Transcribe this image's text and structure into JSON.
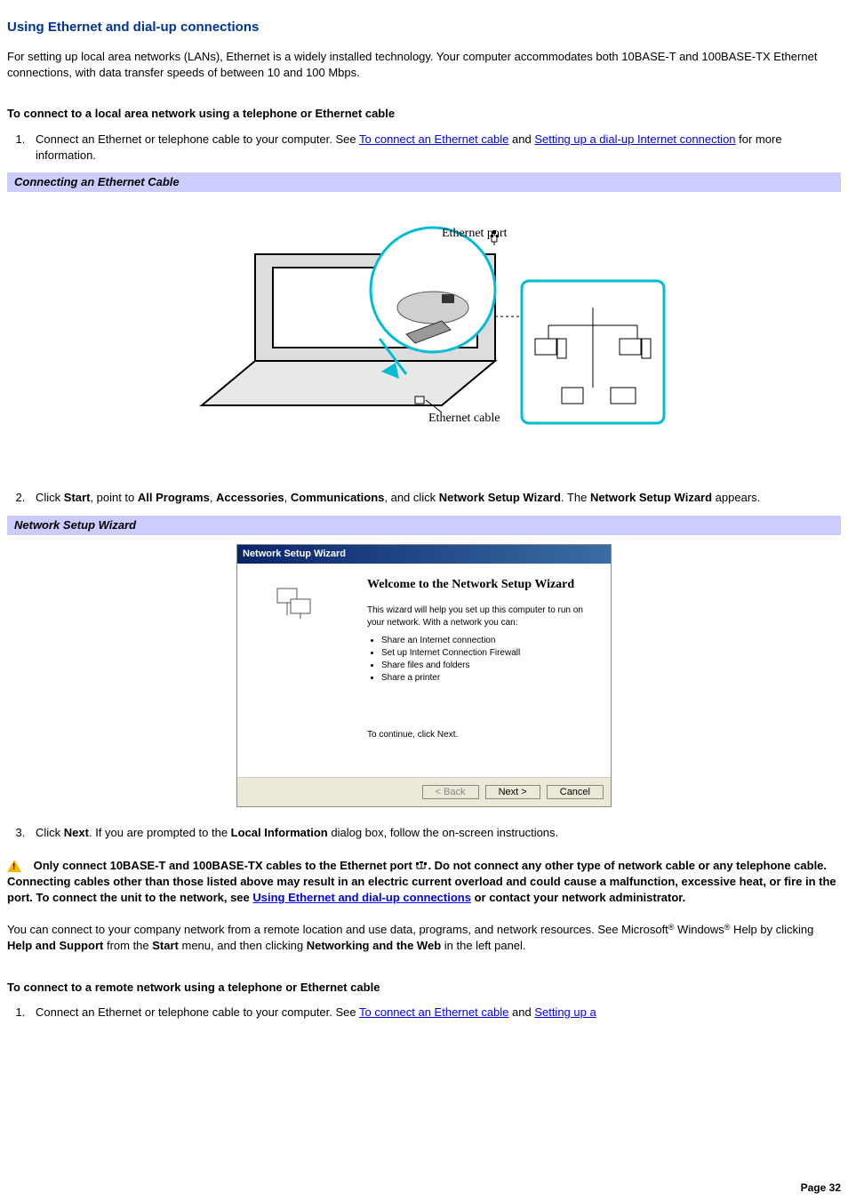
{
  "title": "Using Ethernet and dial-up connections",
  "intro": "For setting up local area networks (LANs), Ethernet is a widely installed technology. Your computer accommodates both 10BASE-T and 100BASE-TX Ethernet connections, with data transfer speeds of between 10 and 100 Mbps.",
  "section1_heading": "To connect to a local area network using a telephone or Ethernet cable",
  "step1_prefix": "Connect an Ethernet or telephone cable to your computer. See ",
  "step1_link1": "To connect an Ethernet cable",
  "step1_mid": " and ",
  "step1_link2": "Setting up a dial-up Internet connection",
  "step1_suffix": " for more information.",
  "caption1": "Connecting an Ethernet Cable",
  "fig1_label_port": "Ethernet port",
  "fig1_label_cable": "Ethernet cable",
  "step2_pre": "Click ",
  "step2_start": "Start",
  "step2_t1": ", point to ",
  "step2_allprog": "All Programs",
  "step2_c1": ", ",
  "step2_acc": "Accessories",
  "step2_c2": ", ",
  "step2_comm": "Communications",
  "step2_t2": ", and click ",
  "step2_nsw": "Network Setup Wizard",
  "step2_t3": ". The ",
  "step2_nsw2": "Network Setup Wizard",
  "step2_t4": " appears.",
  "caption2": "Network Setup Wizard",
  "wizard": {
    "titlebar": "Network Setup Wizard",
    "heading": "Welcome to the Network Setup Wizard",
    "desc": "This wizard will help you set up this computer to run on your network. With a network you can:",
    "bullets": [
      "Share an Internet connection",
      "Set up Internet Connection Firewall",
      "Share files and folders",
      "Share a printer"
    ],
    "continue": "To continue, click Next.",
    "back": "< Back",
    "next": "Next >",
    "cancel": "Cancel"
  },
  "step3_pre": "Click ",
  "step3_next": "Next",
  "step3_mid": ". If you are prompted to the ",
  "step3_local": "Local Information",
  "step3_suf": " dialog box, follow the on-screen instructions.",
  "warning_pre": "Only connect 10BASE-T and 100BASE-TX cables to the Ethernet port ",
  "warning_mid": ". Do not connect any other type of network cable or any telephone cable. Connecting cables other than those listed above may result in an electric current overload and could cause a malfunction, excessive heat, or fire in the port. To connect the unit to the network, see ",
  "warning_link": "Using Ethernet and dial-up connections",
  "warning_suf": " or contact your network administrator.",
  "remote_p_pre": "You can connect to your company network from a remote location and use data, programs, and network resources. See Microsoft",
  "remote_p_reg1": "®",
  "remote_p_win": " Windows",
  "remote_p_reg2": "®",
  "remote_p_mid": " Help by clicking ",
  "remote_p_hs": "Help and Support",
  "remote_p_from": " from the ",
  "remote_p_start": "Start",
  "remote_p_menu": " menu, and then clicking ",
  "remote_p_nw": "Networking and the Web",
  "remote_p_suf": " in the left panel.",
  "section2_heading": "To connect to a remote network using a telephone or Ethernet cable",
  "r_step1_prefix": "Connect an Ethernet or telephone cable to your computer. See ",
  "r_step1_link1": "To connect an Ethernet cable",
  "r_step1_mid": " and ",
  "r_step1_link2": "Setting up a",
  "page_number": "Page 32"
}
